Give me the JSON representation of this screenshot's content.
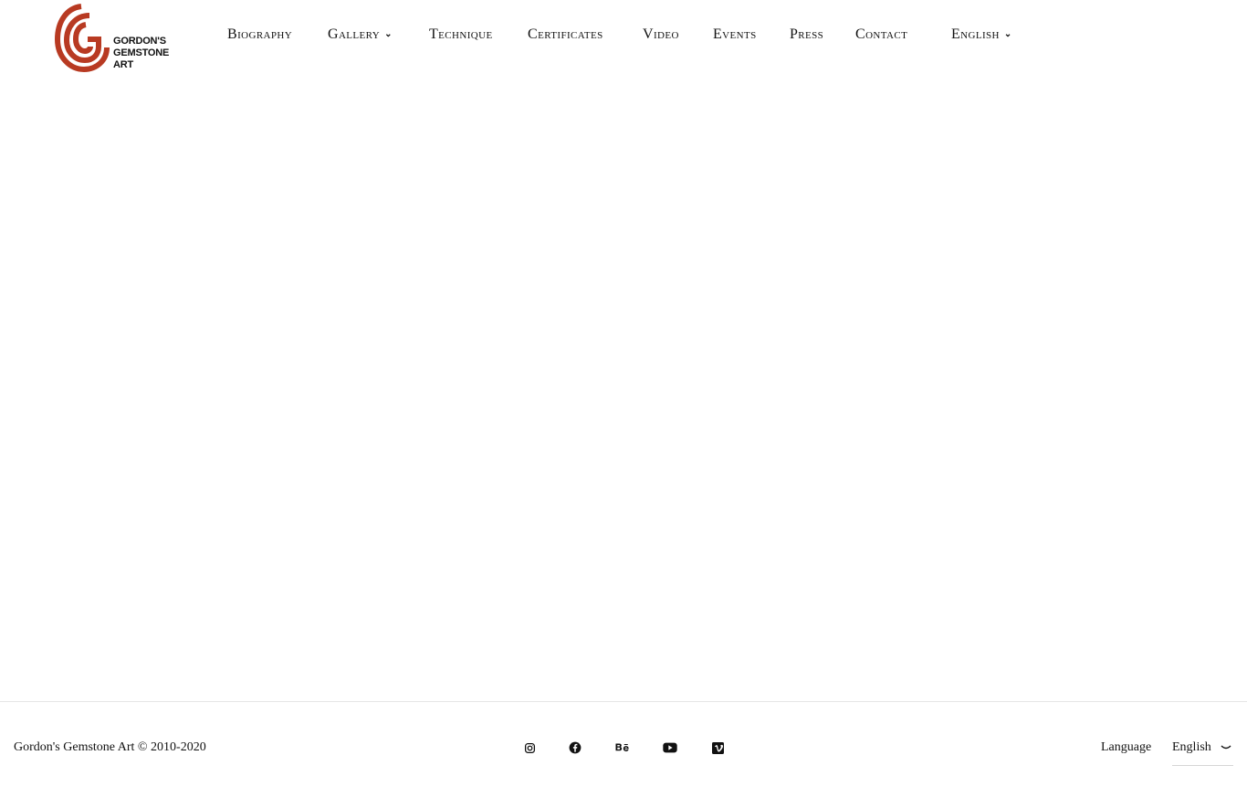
{
  "brand": {
    "name_line1": "GORDON'S",
    "name_line2": "GEMSTONE",
    "name_line3": "ART",
    "accent_color": "#b83a22"
  },
  "nav": {
    "items": [
      {
        "label": "Biography",
        "has_dropdown": false
      },
      {
        "label": "Gallery",
        "has_dropdown": true
      },
      {
        "label": "Technique",
        "has_dropdown": false
      },
      {
        "label": "Certificates",
        "has_dropdown": false
      },
      {
        "label": "Video",
        "has_dropdown": false
      },
      {
        "label": "Events",
        "has_dropdown": false
      },
      {
        "label": "Press",
        "has_dropdown": false
      },
      {
        "label": "Contact",
        "has_dropdown": false
      },
      {
        "label": "English",
        "has_dropdown": true
      }
    ]
  },
  "footer": {
    "copyright": "Gordon's Gemstone Art © 2010-2020",
    "social": [
      "instagram-icon",
      "facebook-icon",
      "behance-icon",
      "youtube-icon",
      "vimeo-icon"
    ],
    "language_label": "Language",
    "language_value": "English"
  }
}
